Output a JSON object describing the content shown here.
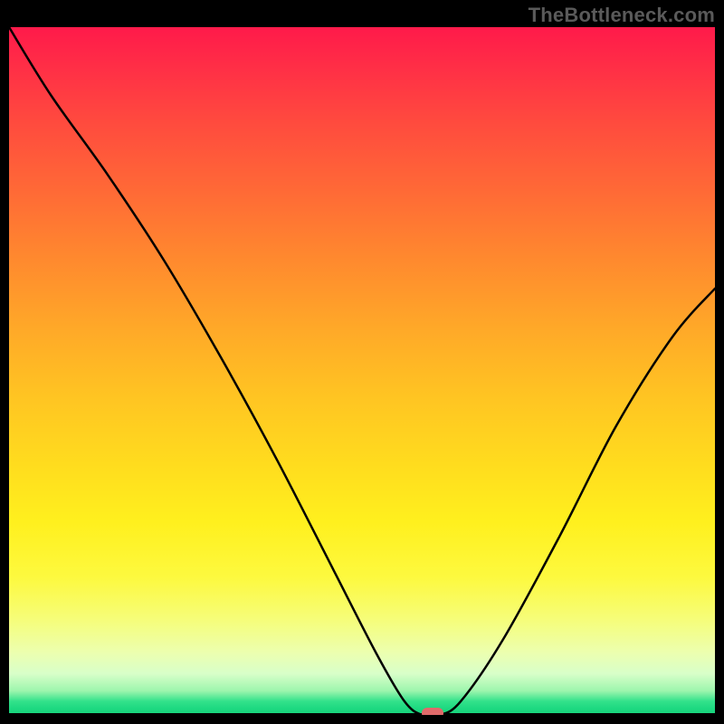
{
  "watermark": "TheBottleneck.com",
  "chart_data": {
    "type": "line",
    "title": "",
    "xlabel": "",
    "ylabel": "",
    "xlim": [
      0,
      100
    ],
    "ylim": [
      0,
      100
    ],
    "grid": false,
    "legend": false,
    "background_gradient": {
      "stops": [
        {
          "pos": 0,
          "color": "#ff1a4a"
        },
        {
          "pos": 50,
          "color": "#ffc522"
        },
        {
          "pos": 80,
          "color": "#fdf93f"
        },
        {
          "pos": 95,
          "color": "#d8ffc9"
        },
        {
          "pos": 100,
          "color": "#17d47c"
        }
      ]
    },
    "series": [
      {
        "name": "bottleneck-curve",
        "x": [
          0,
          6,
          14,
          22,
          30,
          38,
          46,
          52,
          56,
          58.5,
          61,
          64,
          70,
          78,
          86,
          94,
          100
        ],
        "y": [
          100,
          90,
          78.5,
          66,
          52,
          37,
          21,
          9,
          2,
          0,
          0,
          2,
          11,
          26,
          42,
          55,
          62
        ]
      }
    ],
    "marker": {
      "x": 60,
      "y": 0,
      "shape": "pill",
      "color": "#e06a6a"
    }
  }
}
